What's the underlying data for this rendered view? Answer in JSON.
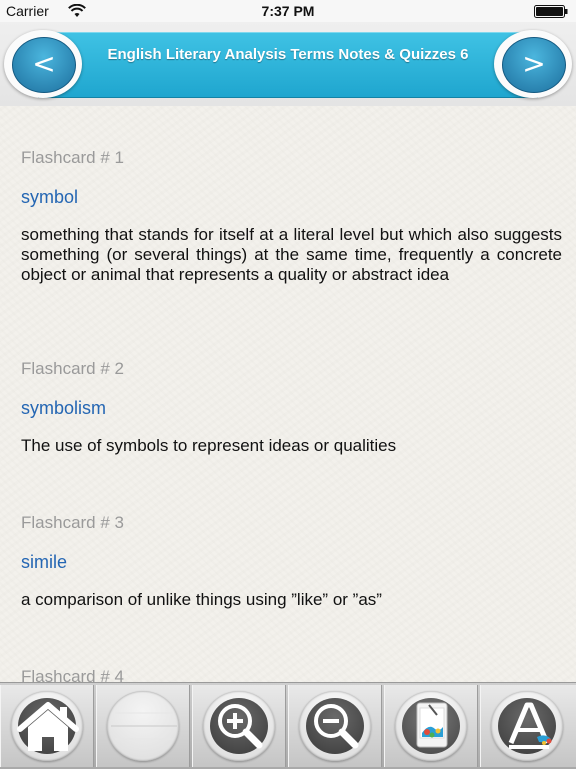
{
  "status_bar": {
    "carrier": "Carrier",
    "time": "7:37 PM"
  },
  "header": {
    "title": "English Literary Analysis Terms Notes & Quizzes 6",
    "prev_glyph": "<",
    "next_glyph": ">"
  },
  "flashcards": [
    {
      "number": "Flashcard # 1",
      "term": "symbol",
      "definition": "something that stands for itself at a literal level but which also suggests something (or several things) at the same time, frequently a concrete object or animal that represents a quality or abstract idea"
    },
    {
      "number": "Flashcard # 2",
      "term": "symbolism",
      "definition": "The use of symbols to represent ideas or qualities"
    },
    {
      "number": "Flashcard # 3",
      "term": "simile",
      "definition": "a comparison of unlike things using ”like” or ”as”"
    },
    {
      "number": "Flashcard # 4",
      "term": "",
      "definition": ""
    }
  ],
  "toolbar": {
    "icons": [
      "home-icon",
      "blank-icon",
      "zoom-in-icon",
      "zoom-out-icon",
      "flashcards-icon",
      "font-icon"
    ]
  },
  "colors": {
    "banner": "#1fa6cf",
    "term": "#2466b3",
    "card_number": "#9a9a9a"
  }
}
